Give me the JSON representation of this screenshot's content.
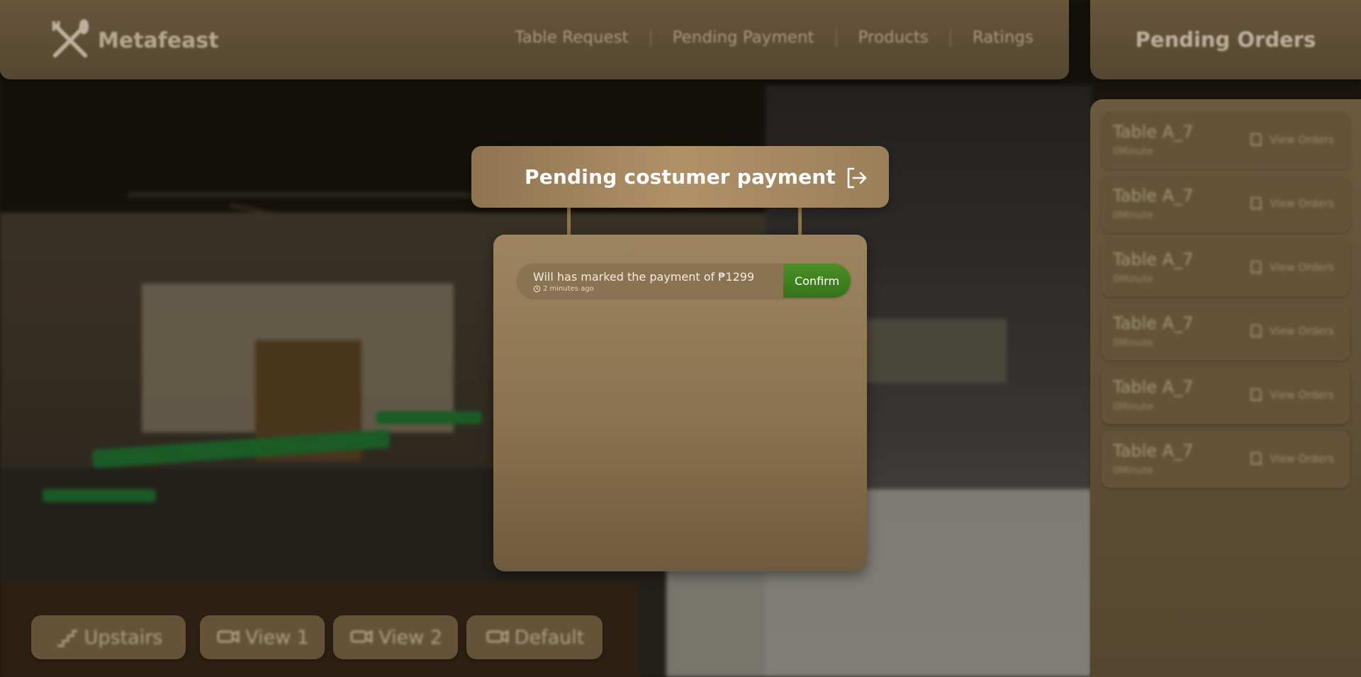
{
  "brand": {
    "name": "Metafeast"
  },
  "nav": {
    "links": [
      {
        "label": "Table Request"
      },
      {
        "label": "Pending Payment"
      },
      {
        "label": "Products"
      },
      {
        "label": "Ratings"
      }
    ]
  },
  "pending_orders": {
    "title": "Pending Orders",
    "orders": [
      {
        "table": "Table A_7",
        "time": "0Minute",
        "action": "View Orders"
      },
      {
        "table": "Table A_7",
        "time": "0Minute",
        "action": "View Orders"
      },
      {
        "table": "Table A_7",
        "time": "0Minute",
        "action": "View Orders"
      },
      {
        "table": "Table A_7",
        "time": "0Minute",
        "action": "View Orders"
      },
      {
        "table": "Table A_7",
        "time": "0Minute",
        "action": "View Orders"
      },
      {
        "table": "Table A_7",
        "time": "0Minute",
        "action": "View Orders"
      }
    ]
  },
  "camera_buttons": [
    {
      "label": "Upstairs",
      "icon": "stairs-icon"
    },
    {
      "label": "View 1",
      "icon": "camera-icon"
    },
    {
      "label": "View 2",
      "icon": "camera-icon"
    },
    {
      "label": "Default",
      "icon": "camera-icon"
    }
  ],
  "modal": {
    "title": "Pending costumer payment",
    "exit_icon": "exit-icon",
    "payments": [
      {
        "message": "Will has marked the payment of ₱1299",
        "time": "2 minutes ago",
        "confirm_label": "Confirm"
      }
    ]
  },
  "colors": {
    "panel": "#725f43",
    "modal_header": "#b09168",
    "confirm_green": "#3f821f",
    "text_light": "#ffffff"
  }
}
